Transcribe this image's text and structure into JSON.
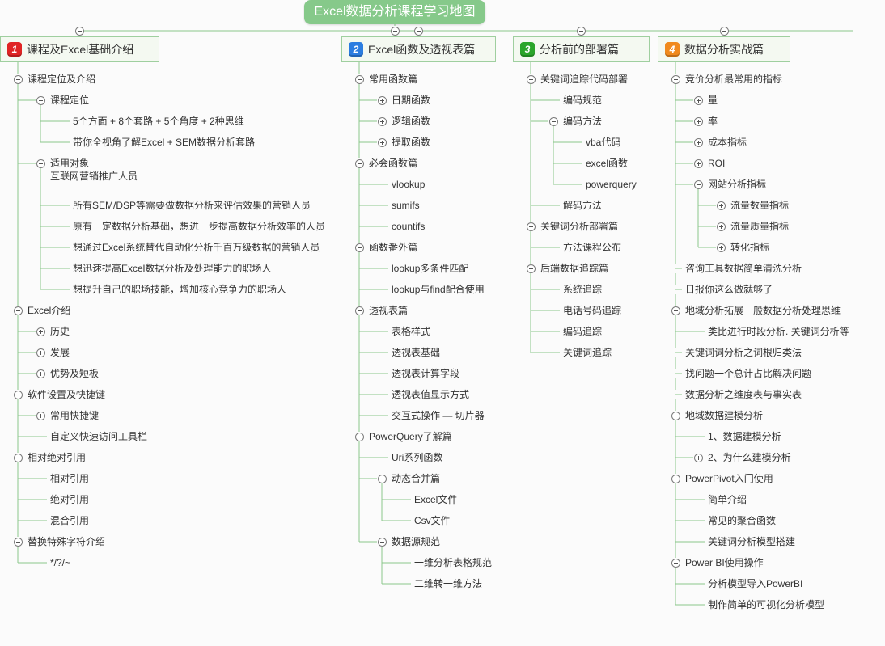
{
  "title": "Excel数据分析课程学习地图",
  "colors": {
    "root_bg": "#86c98a",
    "line": "#8bc78b",
    "badge": [
      "#e02424",
      "#2b7de0",
      "#2aa52a",
      "#f08a1e"
    ]
  },
  "branches": [
    {
      "num": "1",
      "label": "课程及Excel基础介绍",
      "items": [
        {
          "label": "课程定位及介绍",
          "children": [
            {
              "label": "课程定位",
              "children": [
                {
                  "label": "5个方面 + 8个套路 + 5个角度 + 2种思维"
                },
                {
                  "label": "带你全视角了解Excel + SEM数据分析套路"
                }
              ]
            },
            {
              "label": "适用对象",
              "label2": "互联网营销推广人员",
              "children": [
                {
                  "label": "所有SEM/DSP等需要做数据分析来评估效果的营销人员"
                },
                {
                  "label": "原有一定数据分析基础，想进一步提高数据分析效率的人员"
                },
                {
                  "label": "想通过Excel系统替代自动化分析千百万级数据的营销人员"
                },
                {
                  "label": "想迅速提高Excel数据分析及处理能力的职场人"
                },
                {
                  "label": "想提升自己的职场技能，增加核心竞争力的职场人"
                }
              ]
            }
          ]
        },
        {
          "label": "Excel介绍",
          "children": [
            {
              "label": "历史",
              "collapsed": true
            },
            {
              "label": "发展",
              "collapsed": true
            },
            {
              "label": "优势及短板",
              "collapsed": true
            }
          ]
        },
        {
          "label": "软件设置及快捷键",
          "children": [
            {
              "label": "常用快捷键",
              "collapsed": true
            },
            {
              "label": "自定义快速访问工具栏"
            }
          ]
        },
        {
          "label": "相对绝对引用",
          "children": [
            {
              "label": "相对引用"
            },
            {
              "label": "绝对引用"
            },
            {
              "label": "混合引用"
            }
          ]
        },
        {
          "label": "替换特殊字符介绍",
          "children": [
            {
              "label": "*/?/~"
            }
          ]
        }
      ]
    },
    {
      "num": "2",
      "label": "Excel函数及透视表篇",
      "items": [
        {
          "label": "常用函数篇",
          "children": [
            {
              "label": "日期函数",
              "collapsed": true
            },
            {
              "label": "逻辑函数",
              "collapsed": true
            },
            {
              "label": "提取函数",
              "collapsed": true
            }
          ]
        },
        {
          "label": "必会函数篇",
          "children": [
            {
              "label": "vlookup"
            },
            {
              "label": "sumifs"
            },
            {
              "label": "countifs"
            }
          ]
        },
        {
          "label": "函数番外篇",
          "children": [
            {
              "label": "lookup多条件匹配"
            },
            {
              "label": "lookup与find配合使用"
            }
          ]
        },
        {
          "label": "透视表篇",
          "children": [
            {
              "label": "表格样式"
            },
            {
              "label": "透视表基础"
            },
            {
              "label": "透视表计算字段"
            },
            {
              "label": "透视表值显示方式"
            },
            {
              "label": "交互式操作 — 切片器"
            }
          ]
        },
        {
          "label": "PowerQuery了解篇",
          "children": [
            {
              "label": "Uri系列函数"
            },
            {
              "label": "动态合并篇",
              "children": [
                {
                  "label": "Excel文件"
                },
                {
                  "label": "Csv文件"
                }
              ]
            },
            {
              "label": "数据源规范",
              "children": [
                {
                  "label": "一维分析表格规范"
                },
                {
                  "label": "二维转一维方法"
                }
              ]
            }
          ]
        }
      ]
    },
    {
      "num": "3",
      "label": "分析前的部署篇",
      "items": [
        {
          "label": "关键词追踪代码部署",
          "children": [
            {
              "label": "编码规范"
            },
            {
              "label": "编码方法",
              "children": [
                {
                  "label": "vba代码"
                },
                {
                  "label": "excel函数"
                },
                {
                  "label": "powerquery"
                }
              ]
            },
            {
              "label": "解码方法"
            }
          ]
        },
        {
          "label": "关键词分析部署篇",
          "children": [
            {
              "label": "方法课程公布"
            }
          ]
        },
        {
          "label": "后端数据追踪篇",
          "children": [
            {
              "label": "系统追踪"
            },
            {
              "label": "电话号码追踪"
            },
            {
              "label": "编码追踪"
            },
            {
              "label": "关键词追踪"
            }
          ]
        }
      ]
    },
    {
      "num": "4",
      "label": "数据分析实战篇",
      "items": [
        {
          "label": "竞价分析最常用的指标",
          "children": [
            {
              "label": "量",
              "collapsed": true
            },
            {
              "label": "率",
              "collapsed": true
            },
            {
              "label": "成本指标",
              "collapsed": true
            },
            {
              "label": "ROI",
              "collapsed": true
            },
            {
              "label": "网站分析指标",
              "children": [
                {
                  "label": "流量数量指标",
                  "collapsed": true
                },
                {
                  "label": "流量质量指标",
                  "collapsed": true
                },
                {
                  "label": "转化指标",
                  "collapsed": true
                }
              ]
            }
          ]
        },
        {
          "label": "咨询工具数据简单清洗分析"
        },
        {
          "label": "日报你这么做就够了"
        },
        {
          "label": "地域分析拓展一般数据分析处理思维",
          "children": [
            {
              "label": "类比进行时段分析. 关键词分析等"
            }
          ]
        },
        {
          "label": "关键词词分析之词根归类法"
        },
        {
          "label": "找问题一个总计占比解决问题"
        },
        {
          "label": "数据分析之维度表与事实表"
        },
        {
          "label": "地域数据建模分析",
          "children": [
            {
              "label": "1、数据建模分析"
            },
            {
              "label": "2、为什么建模分析",
              "collapsed": true
            }
          ]
        },
        {
          "label": "PowerPivot入门使用",
          "children": [
            {
              "label": "简单介绍"
            },
            {
              "label": "常见的聚合函数"
            },
            {
              "label": "关键词分析模型搭建"
            }
          ]
        },
        {
          "label": "Power BI使用操作",
          "children": [
            {
              "label": "分析模型导入PowerBI"
            },
            {
              "label": "制作简单的可视化分析模型"
            }
          ]
        }
      ]
    }
  ]
}
